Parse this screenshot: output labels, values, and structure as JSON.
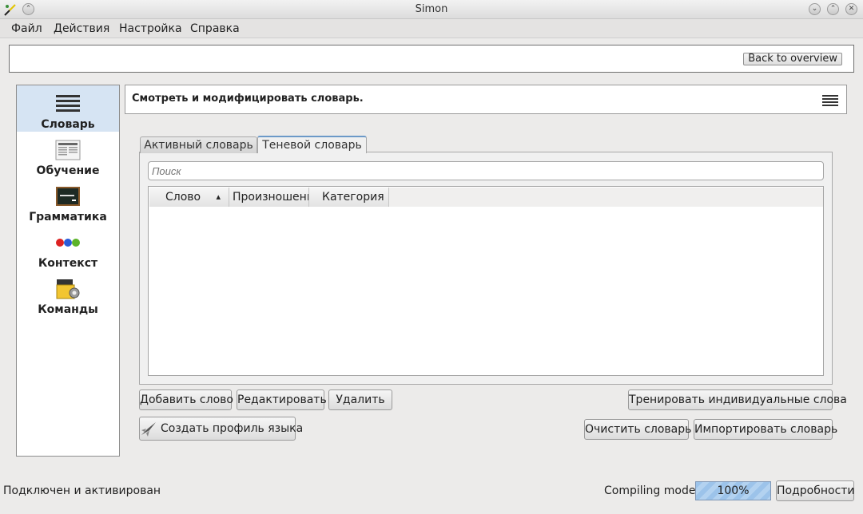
{
  "window": {
    "title": "Simon"
  },
  "menu": [
    "Файл",
    "Действия",
    "Настройка",
    "Справка"
  ],
  "overview": {
    "back_label": "Back to overview"
  },
  "sidebar": {
    "items": [
      {
        "label": "Словарь",
        "icon": "dictionary-icon",
        "active": true
      },
      {
        "label": "Обучение",
        "icon": "training-icon",
        "active": false
      },
      {
        "label": "Грамматика",
        "icon": "grammar-icon",
        "active": false
      },
      {
        "label": "Контекст",
        "icon": "context-icon",
        "active": false
      },
      {
        "label": "Команды",
        "icon": "commands-icon",
        "active": false
      }
    ]
  },
  "main": {
    "header": "Смотреть и модифицировать словарь.",
    "tabs": [
      {
        "label": "Активный словарь",
        "active": false
      },
      {
        "label": "Теневой словарь",
        "active": true
      }
    ],
    "search_placeholder": "Поиск",
    "table": {
      "columns": [
        "Слово",
        "Произношение",
        "Категория"
      ],
      "rows": []
    },
    "buttons": {
      "add_word": "Добавить слово",
      "edit": "Редактировать",
      "delete": "Удалить",
      "train_words": "Тренировать индивидуальные слова",
      "create_profile": "Создать профиль языка",
      "clear_dictionary": "Очистить словарь",
      "import_dictionary": "Импортировать словарь"
    }
  },
  "status": {
    "connection": "Подключен и активирован",
    "task": "Compiling model",
    "progress_text": "100%",
    "progress_value": 100,
    "details_label": "Подробности"
  },
  "colors": {
    "active_item": "#d6e4f3",
    "progress": "#9cc3ea",
    "tab_accent": "#6c99c8"
  }
}
